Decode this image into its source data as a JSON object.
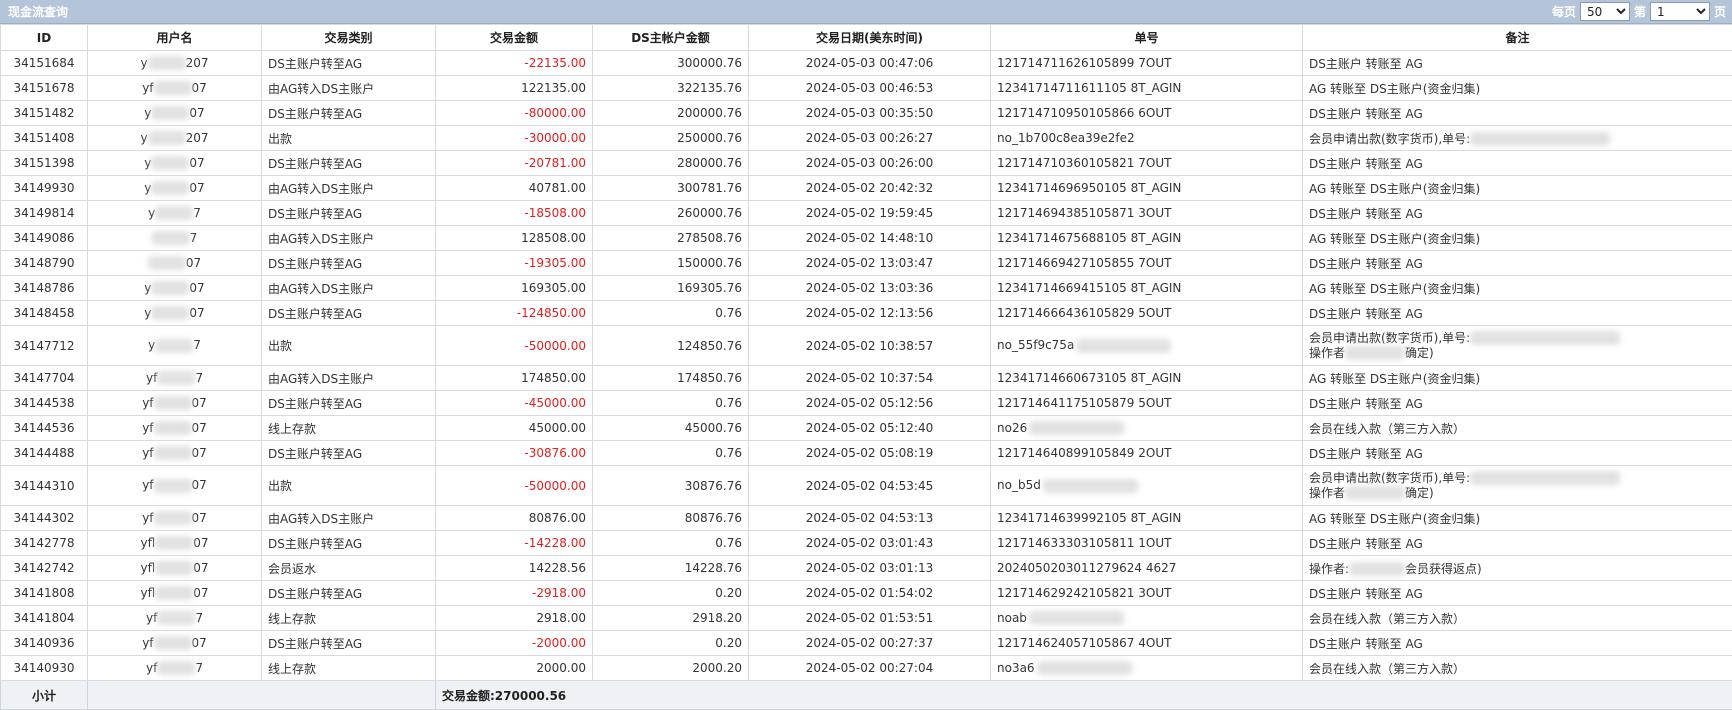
{
  "window": {
    "title": "现金流查询"
  },
  "pager": {
    "per_page_label": "每页",
    "per_page_value": "50",
    "page_prefix": "第",
    "page_value": "1",
    "page_suffix": "页"
  },
  "columns": [
    "ID",
    "用户名",
    "交易类别",
    "交易金额",
    "DS主帐户金额",
    "交易日期(美东时间)",
    "单号",
    "备注"
  ],
  "rows": [
    {
      "id": "34151684",
      "user": "y",
      "user_end": "207",
      "type": "DS主账户转至AG",
      "amount": "-22135.00",
      "neg": true,
      "balance": "300000.76",
      "date": "2024-05-03 00:47:06",
      "order": "121714711626105899 7OUT",
      "note": "DS主账户 转账至 AG"
    },
    {
      "id": "34151678",
      "user": "yf",
      "user_end": "07",
      "type": "由AG转入DS主账户",
      "amount": "122135.00",
      "neg": false,
      "balance": "322135.76",
      "date": "2024-05-03 00:46:53",
      "order": "12341714711611105 8T_AGIN",
      "note": "AG 转账至 DS主账户(资金归集)"
    },
    {
      "id": "34151482",
      "user": "y",
      "user_end": "07",
      "type": "DS主账户转至AG",
      "amount": "-80000.00",
      "neg": true,
      "balance": "200000.76",
      "date": "2024-05-03 00:35:50",
      "order": "121714710950105866 6OUT",
      "note": "DS主账户 转账至 AG"
    },
    {
      "id": "34151408",
      "user": "y",
      "user_end": "207",
      "type": "出款",
      "amount": "-30000.00",
      "neg": true,
      "balance": "250000.76",
      "date": "2024-05-03 00:26:27",
      "order": "no_1b700c8ea39e2fe2",
      "note": "会员申请出款(数字货币),单号:"
    },
    {
      "id": "34151398",
      "user": "y",
      "user_end": "07",
      "type": "DS主账户转至AG",
      "amount": "-20781.00",
      "neg": true,
      "balance": "280000.76",
      "date": "2024-05-03 00:26:00",
      "order": "121714710360105821 7OUT",
      "note": "DS主账户 转账至 AG"
    },
    {
      "id": "34149930",
      "user": "y",
      "user_end": "07",
      "type": "由AG转入DS主账户",
      "amount": "40781.00",
      "neg": false,
      "balance": "300781.76",
      "date": "2024-05-02 20:42:32",
      "order": "12341714696950105 8T_AGIN",
      "note": "AG 转账至 DS主账户(资金归集)"
    },
    {
      "id": "34149814",
      "user": "y",
      "user_end": "7",
      "type": "DS主账户转至AG",
      "amount": "-18508.00",
      "neg": true,
      "balance": "260000.76",
      "date": "2024-05-02 19:59:45",
      "order": "121714694385105871 3OUT",
      "note": "DS主账户 转账至 AG"
    },
    {
      "id": "34149086",
      "user": "",
      "user_end": "7",
      "type": "由AG转入DS主账户",
      "amount": "128508.00",
      "neg": false,
      "balance": "278508.76",
      "date": "2024-05-02 14:48:10",
      "order": "12341714675688105 8T_AGIN",
      "note": "AG 转账至 DS主账户(资金归集)"
    },
    {
      "id": "34148790",
      "user": "",
      "user_end": "07",
      "type": "DS主账户转至AG",
      "amount": "-19305.00",
      "neg": true,
      "balance": "150000.76",
      "date": "2024-05-02 13:03:47",
      "order": "121714669427105855 7OUT",
      "note": "DS主账户 转账至 AG"
    },
    {
      "id": "34148786",
      "user": "y",
      "user_end": "07",
      "type": "由AG转入DS主账户",
      "amount": "169305.00",
      "neg": false,
      "balance": "169305.76",
      "date": "2024-05-02 13:03:36",
      "order": "12341714669415105 8T_AGIN",
      "note": "AG 转账至 DS主账户(资金归集)"
    },
    {
      "id": "34148458",
      "user": "y",
      "user_end": "07",
      "type": "DS主账户转至AG",
      "amount": "-124850.00",
      "neg": true,
      "balance": "0.76",
      "date": "2024-05-02 12:13:56",
      "order": "121714666436105829 5OUT",
      "note": "DS主账户 转账至 AG"
    },
    {
      "id": "34147712",
      "user": "y",
      "user_end": "7",
      "type": "出款",
      "amount": "-50000.00",
      "neg": true,
      "balance": "124850.76",
      "date": "2024-05-02 10:38:57",
      "order": "no_55f9c75a",
      "note": "会员申请出款(数字货币),单号:",
      "note2a": "操作者",
      "note2b": "确定)",
      "tall": true
    },
    {
      "id": "34147704",
      "user": "yf",
      "user_end": "7",
      "type": "由AG转入DS主账户",
      "amount": "174850.00",
      "neg": false,
      "balance": "174850.76",
      "date": "2024-05-02 10:37:54",
      "order": "12341714660673105 8T_AGIN",
      "note": "AG 转账至 DS主账户(资金归集)"
    },
    {
      "id": "34144538",
      "user": "yf",
      "user_end": "07",
      "type": "DS主账户转至AG",
      "amount": "-45000.00",
      "neg": true,
      "balance": "0.76",
      "date": "2024-05-02 05:12:56",
      "order": "121714641175105879 5OUT",
      "note": "DS主账户 转账至 AG"
    },
    {
      "id": "34144536",
      "user": "yf",
      "user_end": "07",
      "type": "线上存款",
      "amount": "45000.00",
      "neg": false,
      "balance": "45000.76",
      "date": "2024-05-02 05:12:40",
      "order": "no26",
      "note": "会员在线入款（第三方入款）"
    },
    {
      "id": "34144488",
      "user": "yf",
      "user_end": "07",
      "type": "DS主账户转至AG",
      "amount": "-30876.00",
      "neg": true,
      "balance": "0.76",
      "date": "2024-05-02 05:08:19",
      "order": "121714640899105849 2OUT",
      "note": "DS主账户 转账至 AG"
    },
    {
      "id": "34144310",
      "user": "yf",
      "user_end": "07",
      "type": "出款",
      "amount": "-50000.00",
      "neg": true,
      "balance": "30876.76",
      "date": "2024-05-02 04:53:45",
      "order": "no_b5d",
      "note": "会员申请出款(数字货币),单号:",
      "note2a": "操作者",
      "note2b": "确定)",
      "tall": true
    },
    {
      "id": "34144302",
      "user": "yf",
      "user_end": "07",
      "type": "由AG转入DS主账户",
      "amount": "80876.00",
      "neg": false,
      "balance": "80876.76",
      "date": "2024-05-02 04:53:13",
      "order": "12341714639992105 8T_AGIN",
      "note": "AG 转账至 DS主账户(资金归集)"
    },
    {
      "id": "34142778",
      "user": "yfl",
      "user_end": "07",
      "type": "DS主账户转至AG",
      "amount": "-14228.00",
      "neg": true,
      "balance": "0.76",
      "date": "2024-05-02 03:01:43",
      "order": "121714633303105811 1OUT",
      "note": "DS主账户 转账至 AG"
    },
    {
      "id": "34142742",
      "user": "yfl",
      "user_end": "07",
      "type": "会员返水",
      "amount": "14228.56",
      "neg": false,
      "balance": "14228.76",
      "date": "2024-05-02 03:01:13",
      "order": "2024050203011279624 4627",
      "note": "操作者:",
      "note_tail": "会员获得返点)"
    },
    {
      "id": "34141808",
      "user": "yfl",
      "user_end": "07",
      "type": "DS主账户转至AG",
      "amount": "-2918.00",
      "neg": true,
      "balance": "0.20",
      "date": "2024-05-02 01:54:02",
      "order": "121714629242105821 3OUT",
      "note": "DS主账户 转账至 AG"
    },
    {
      "id": "34141804",
      "user": "yf",
      "user_end": "7",
      "type": "线上存款",
      "amount": "2918.00",
      "neg": false,
      "balance": "2918.20",
      "date": "2024-05-02 01:53:51",
      "order": "noab",
      "note": "会员在线入款（第三方入款）"
    },
    {
      "id": "34140936",
      "user": "yf",
      "user_end": "07",
      "type": "DS主账户转至AG",
      "amount": "-2000.00",
      "neg": true,
      "balance": "0.20",
      "date": "2024-05-02 00:27:37",
      "order": "121714624057105867 4OUT",
      "note": "DS主账户 转账至 AG"
    },
    {
      "id": "34140930",
      "user": "yf",
      "user_end": "7",
      "type": "线上存款",
      "amount": "2000.00",
      "neg": false,
      "balance": "2000.20",
      "date": "2024-05-02 00:27:04",
      "order": "no3a6",
      "note": "会员在线入款（第三方入款）"
    }
  ],
  "footer": {
    "label": "小计",
    "total": "交易金额:270000.56"
  }
}
